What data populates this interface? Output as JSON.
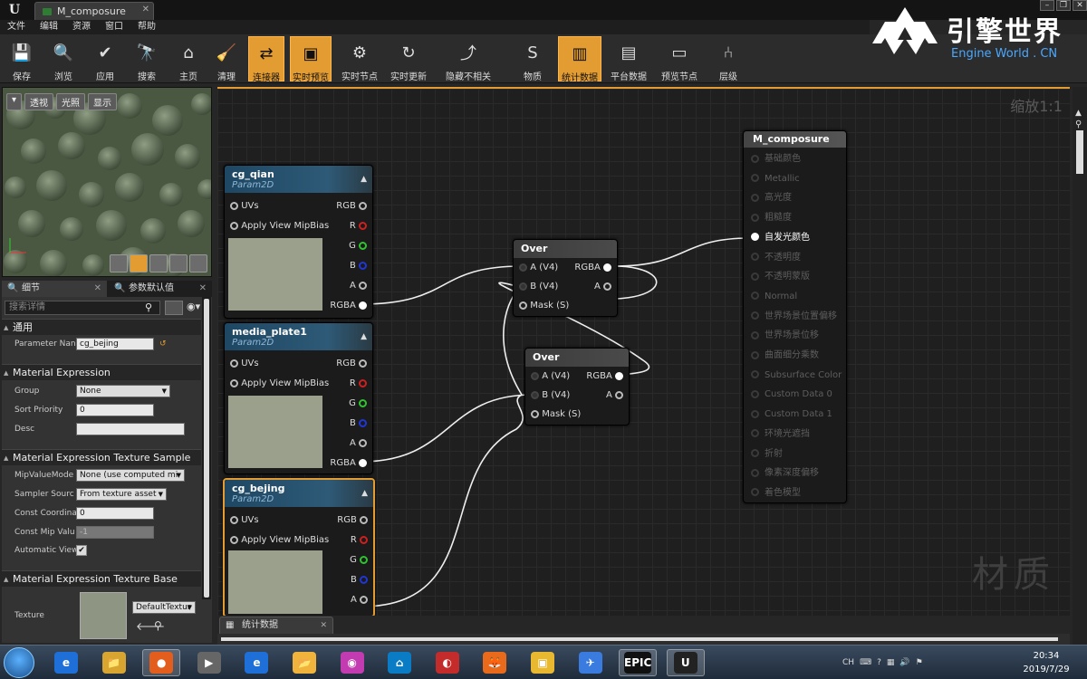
{
  "window": {
    "tab_title": "M_composure"
  },
  "menu": [
    "文件",
    "编辑",
    "资源",
    "窗口",
    "帮助"
  ],
  "toolbar": [
    {
      "label": "保存",
      "icon": "💾",
      "active": false
    },
    {
      "label": "浏览",
      "icon": "🔍",
      "active": false
    },
    {
      "label": "应用",
      "icon": "✔",
      "active": false
    },
    {
      "label": "搜索",
      "icon": "🔭",
      "active": false
    },
    {
      "label": "主页",
      "icon": "⌂",
      "active": false
    },
    {
      "label": "清理",
      "icon": "🧹",
      "active": false
    },
    {
      "label": "连接器",
      "icon": "⇄",
      "active": true
    },
    {
      "label": "实时预览",
      "icon": "▣",
      "active": true
    },
    {
      "label": "实时节点",
      "icon": "⚙",
      "active": false
    },
    {
      "label": "实时更新",
      "icon": "↻",
      "active": false
    },
    {
      "label": "隐藏不相关",
      "icon": "⤴",
      "active": false
    },
    {
      "label": "物质",
      "icon": "S",
      "active": false
    },
    {
      "label": "统计数据",
      "icon": "▥",
      "active": true
    },
    {
      "label": "平台数据",
      "icon": "▤",
      "active": false
    },
    {
      "label": "预览节点",
      "icon": "▭",
      "active": false
    },
    {
      "label": "层级",
      "icon": "⑃",
      "active": false
    }
  ],
  "brand": {
    "title": "引擎世界",
    "subtitle": "Engine World . CN"
  },
  "viewport": {
    "buttons": [
      "透视",
      "光照",
      "显示"
    ]
  },
  "panel_tabs": {
    "details": "细节",
    "defaults": "参数默认值"
  },
  "details": {
    "search_placeholder": "搜索详情",
    "sections": {
      "general": "通用",
      "material_expression": "Material Expression",
      "texture_sample": "Material Expression Texture Sample",
      "texture_base": "Material Expression Texture Base"
    },
    "param_name_label": "Parameter Nan",
    "param_name_value": "cg_bejing",
    "group_label": "Group",
    "group_value": "None",
    "sort_priority_label": "Sort Priority",
    "sort_priority_value": "0",
    "desc_label": "Desc",
    "mip_mode_label": "MipValueMode",
    "mip_mode_value": "None (use computed mi",
    "sampler_label": "Sampler Sourc",
    "sampler_value": "From texture asset",
    "const_coord_label": "Const Coordina",
    "const_coord_value": "0",
    "const_mip_label": "Const Mip Valu",
    "const_mip_value": "-1",
    "auto_view_label": "Automatic View",
    "texture_label": "Texture",
    "texture_value": "DefaultTextur"
  },
  "graph": {
    "zoom": "缩放1:1",
    "watermark": "材质",
    "nodes": [
      {
        "title": "cg_qian",
        "subtitle": "Param2D"
      },
      {
        "title": "media_plate1",
        "subtitle": "Param2D"
      },
      {
        "title": "cg_bejing",
        "subtitle": "Param2D"
      }
    ],
    "pins": {
      "uvs": "UVs",
      "mip": "Apply View MipBias",
      "rgb": "RGB",
      "r": "R",
      "g": "G",
      "b": "B",
      "a": "A",
      "rgba": "RGBA"
    },
    "over": {
      "title": "Over",
      "a": "A (V4)",
      "b": "B (V4)",
      "mask": "Mask (S)",
      "rgba": "RGBA",
      "aout": "A"
    },
    "output": {
      "title": "M_composure",
      "inputs": [
        "基础颜色",
        "Metallic",
        "高光度",
        "粗糙度",
        "自发光颜色",
        "不透明度",
        "不透明蒙版",
        "Normal",
        "世界场景位置偏移",
        "世界场景位移",
        "曲面细分乘数",
        "Subsurface Color",
        "Custom Data 0",
        "Custom Data 1",
        "环境光遮挡",
        "折射",
        "像素深度偏移",
        "着色模型"
      ],
      "active_index": 4
    }
  },
  "bottom_tab": "统计数据",
  "taskbar": {
    "apps": [
      "e",
      "📁",
      "●",
      "▶",
      "e",
      "📂",
      "◉",
      "⌂",
      "◐",
      "🦊",
      "▣",
      "✈",
      "EPIC",
      "U"
    ],
    "tray_lang": "CH",
    "time": "20:34",
    "date": "2019/7/29"
  }
}
